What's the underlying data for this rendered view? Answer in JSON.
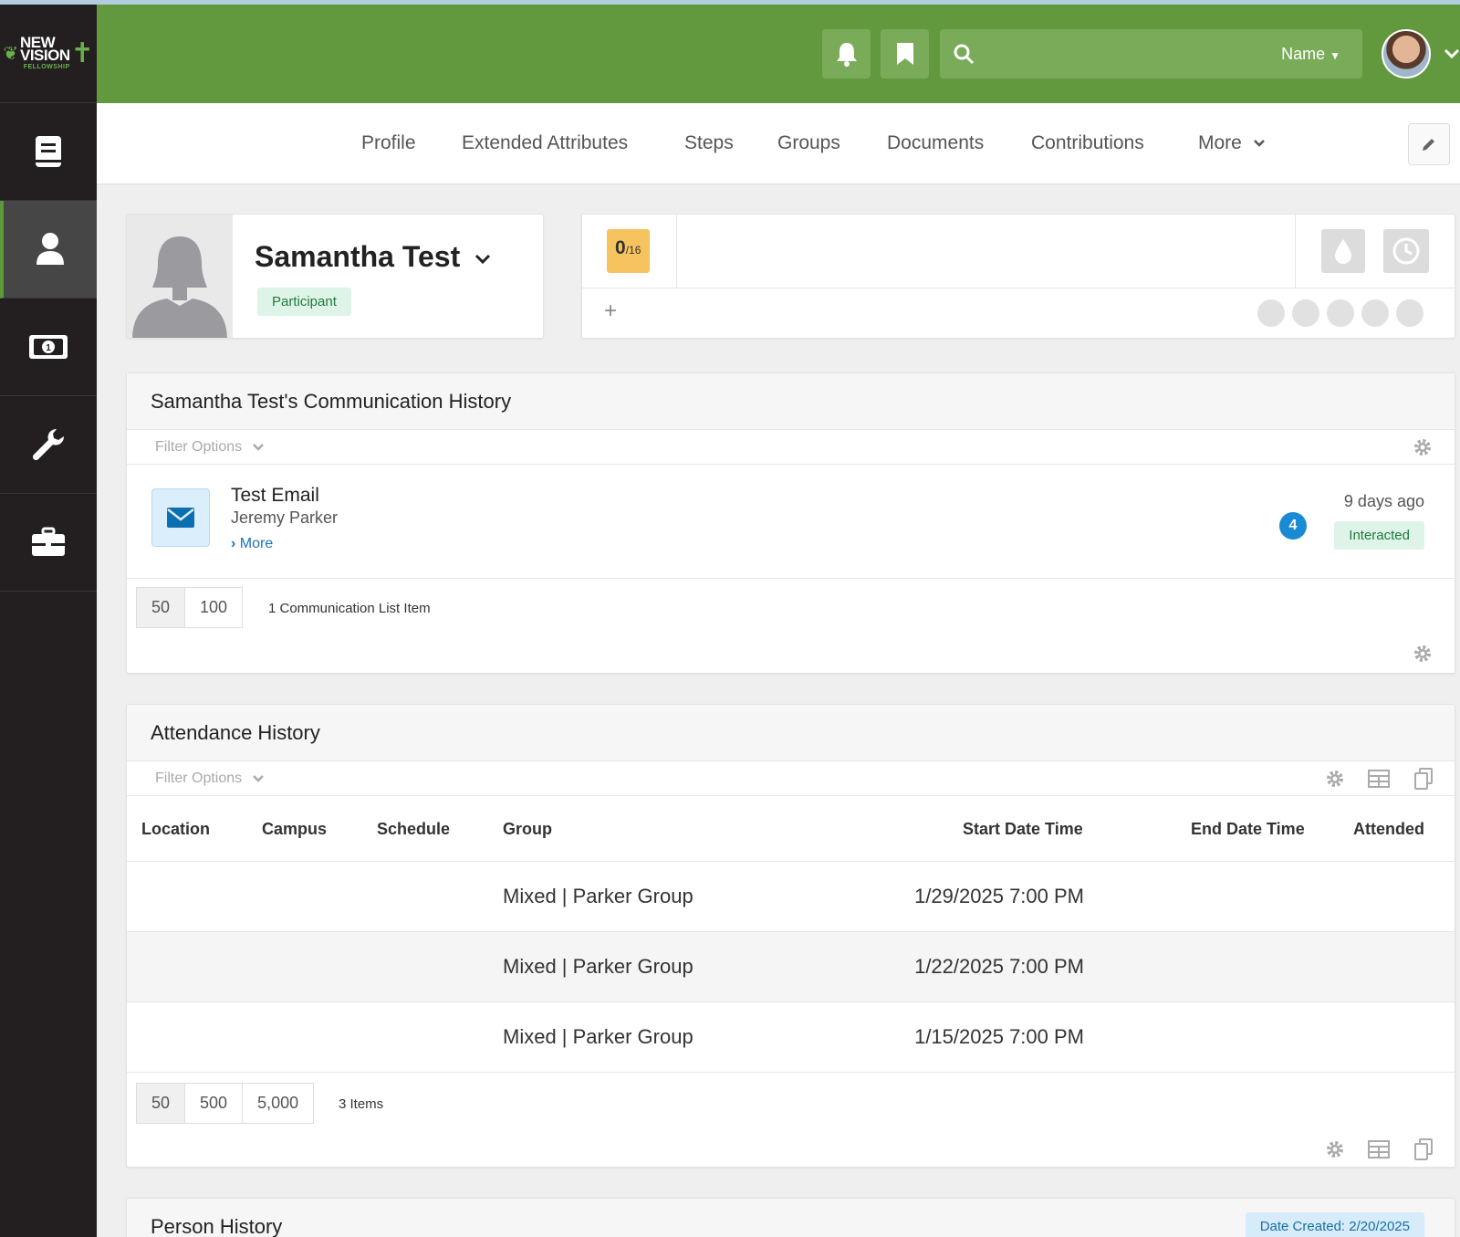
{
  "brand": {
    "logo_line1": "NEW",
    "logo_line2": "VISION",
    "logo_line3": "FELLOWSHIP",
    "primary_color": "#63993e",
    "sidebar_color": "#231f20"
  },
  "sidebar": {
    "items": [
      {
        "icon": "book-icon"
      },
      {
        "icon": "user-icon",
        "active": true
      },
      {
        "icon": "money-icon"
      },
      {
        "icon": "wrench-icon"
      },
      {
        "icon": "briefcase-icon"
      }
    ]
  },
  "header": {
    "search_name_label": "Name"
  },
  "tabs": {
    "profile": "Profile",
    "extended_attributes": "Extended Attributes",
    "steps": "Steps",
    "groups": "Groups",
    "documents": "Documents",
    "contributions": "Contributions",
    "more": "More"
  },
  "person": {
    "name": "Samantha Test",
    "role_badge": "Participant"
  },
  "steps": {
    "completed": "0",
    "total": "/16"
  },
  "communication": {
    "title": "Samantha Test's Communication History",
    "filter_label": "Filter Options",
    "item": {
      "subject": "Test Email",
      "sender": "Jeremy Parker",
      "more_link": "More",
      "time_ago": "9 days ago",
      "count": "4",
      "status": "Interacted"
    },
    "page_sizes": [
      "50",
      "100"
    ],
    "items_count": "1 Communication List Item"
  },
  "attendance": {
    "title": "Attendance History",
    "filter_label": "Filter Options",
    "columns": {
      "location": "Location",
      "campus": "Campus",
      "schedule": "Schedule",
      "group": "Group",
      "start": "Start Date Time",
      "end": "End Date Time",
      "attended": "Attended"
    },
    "rows": [
      {
        "group": "Mixed | Parker Group",
        "start": "1/29/2025 7:00 PM"
      },
      {
        "group": "Mixed | Parker Group",
        "start": "1/22/2025 7:00 PM"
      },
      {
        "group": "Mixed | Parker Group",
        "start": "1/15/2025 7:00 PM"
      }
    ],
    "page_sizes": [
      "50",
      "500",
      "5,000"
    ],
    "items_count": "3 Items"
  },
  "person_history": {
    "title": "Person History",
    "date_created": "Date Created: 2/20/2025"
  }
}
